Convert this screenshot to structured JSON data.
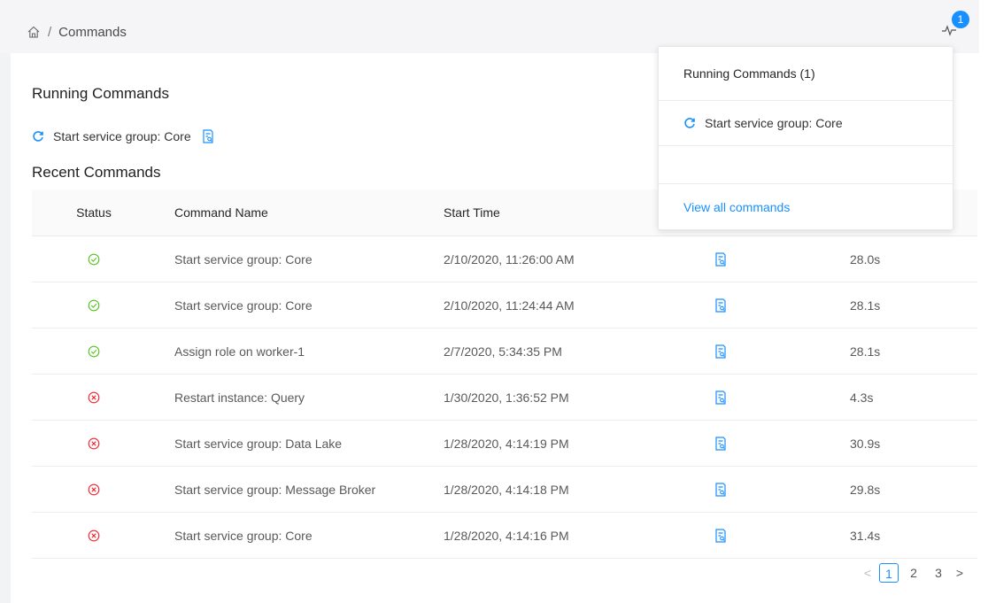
{
  "breadcrumb": {
    "home_icon": "home-icon",
    "separator": "/",
    "current": "Commands"
  },
  "header": {
    "activity_icon": "activity-pulse-icon",
    "notification_count": "1"
  },
  "running": {
    "title": "Running Commands",
    "items": [
      {
        "label": "Start service group: Core",
        "icon": "sync-spinning-icon",
        "log_icon": "log-file-icon"
      }
    ]
  },
  "recent": {
    "title": "Recent Commands",
    "columns": {
      "status": "Status",
      "name": "Command Name",
      "start": "Start Time",
      "log": "",
      "duration": ""
    },
    "rows": [
      {
        "status": "success",
        "name": "Start service group: Core",
        "start": "2/10/2020, 11:26:00 AM",
        "duration": "28.0s"
      },
      {
        "status": "success",
        "name": "Start service group: Core",
        "start": "2/10/2020, 11:24:44 AM",
        "duration": "28.1s"
      },
      {
        "status": "success",
        "name": "Assign role on worker-1",
        "start": "2/7/2020, 5:34:35 PM",
        "duration": "28.1s"
      },
      {
        "status": "failed",
        "name": "Restart instance: Query",
        "start": "1/30/2020, 1:36:52 PM",
        "duration": "4.3s"
      },
      {
        "status": "failed",
        "name": "Start service group: Data Lake",
        "start": "1/28/2020, 4:14:19 PM",
        "duration": "30.9s"
      },
      {
        "status": "failed",
        "name": "Start service group: Message Broker",
        "start": "1/28/2020, 4:14:18 PM",
        "duration": "29.8s"
      },
      {
        "status": "failed",
        "name": "Start service group: Core",
        "start": "1/28/2020, 4:14:16 PM",
        "duration": "31.4s"
      }
    ]
  },
  "pagination": {
    "prev": "<",
    "pages": [
      "1",
      "2",
      "3"
    ],
    "current": "1",
    "next": ">"
  },
  "dropdown": {
    "title": "Running Commands (1)",
    "items": [
      {
        "label": "Start service group: Core"
      }
    ],
    "link": "View all commands"
  },
  "colors": {
    "accent": "#1890ff",
    "success": "#52c41a",
    "error": "#f5222d"
  }
}
